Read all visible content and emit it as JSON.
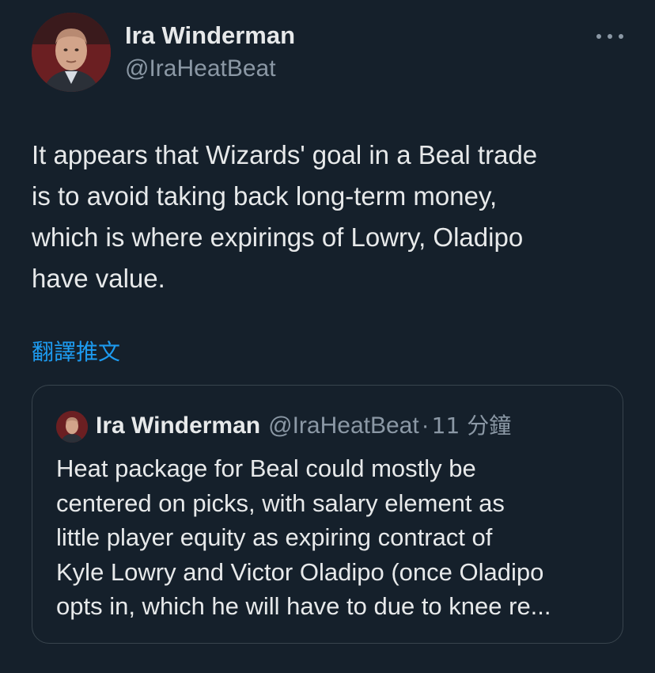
{
  "author": {
    "name": "Ira Winderman",
    "handle": "@IraHeatBeat"
  },
  "tweet": {
    "text": "It appears that Wizards' goal in a Beal trade\nis to avoid taking back long-term money,\nwhich is where expirings of Lowry, Oladipo\nhave value.",
    "translate_label": "翻譯推文"
  },
  "quote": {
    "name": "Ira Winderman",
    "handle": "@IraHeatBeat",
    "separator": "·",
    "time": "11 分鐘",
    "text": "Heat package for Beal could mostly be\ncentered on picks, with salary element as\nlittle player equity as expiring contract of\nKyle Lowry and Victor Oladipo (once Oladipo\nopts in, which he will have to due to knee re..."
  },
  "icons": {
    "more": "more-horizontal-icon"
  },
  "colors": {
    "background": "#15202b",
    "text_primary": "#e7e9ea",
    "text_secondary": "#8b98a5",
    "link": "#1d9bf0",
    "border": "#38444d"
  }
}
